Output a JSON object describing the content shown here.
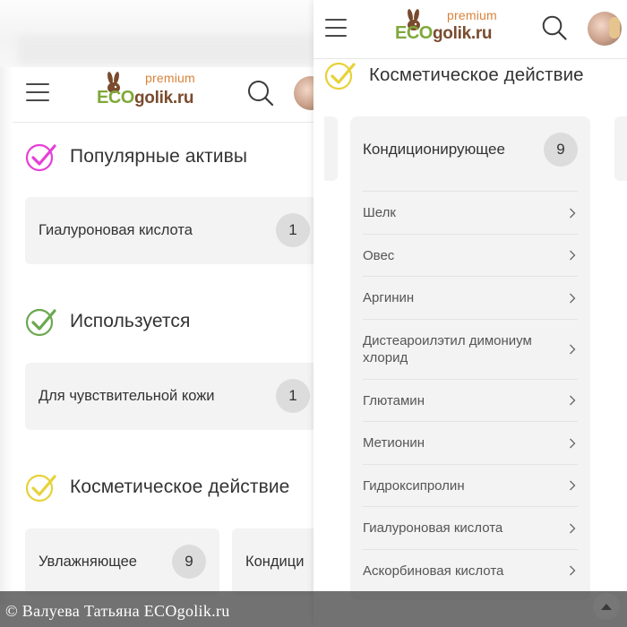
{
  "brand": {
    "premium": "premium",
    "eco": "ECO",
    "golik": "golik.ru"
  },
  "colors": {
    "accent_green": "#7fa83a",
    "brand_brown": "#7a4b2e",
    "premium_orange": "#d9833a",
    "check_magenta": "#e63fd8",
    "check_green": "#6aa84f",
    "check_yellow": "#e6d23a"
  },
  "icons": {
    "menu": "hamburger-icon",
    "search": "search-icon",
    "check": "checkmark-circle-icon",
    "chevron": "chevron-right-icon",
    "scroll_up": "arrow-up-icon"
  },
  "left": {
    "sections": [
      {
        "title": "Популярные активы",
        "card_label": "Гиалуроновая кислота",
        "card_count": "1"
      },
      {
        "title": "Используется",
        "card_label": "Для чувствительной кожи",
        "card_count": "1"
      },
      {
        "title": "Косметическое действие",
        "cards": [
          {
            "label": "Увлажняющее",
            "count": "9"
          },
          {
            "label": "Кондици"
          }
        ]
      }
    ]
  },
  "right": {
    "section_title": "Косметическое действие",
    "dropdown": {
      "label": "Кондиционирующее",
      "count": "9",
      "items": [
        "Шелк",
        "Овес",
        "Аргинин",
        "Дистеароилэтил димониум хлорид",
        "Глютамин",
        "Метионин",
        "Гидроксипролин",
        "Гиалуроновая кислота",
        "Аскорбиновая кислота"
      ]
    }
  },
  "watermark": "© Валуева Татьяна ECOgolik.ru"
}
